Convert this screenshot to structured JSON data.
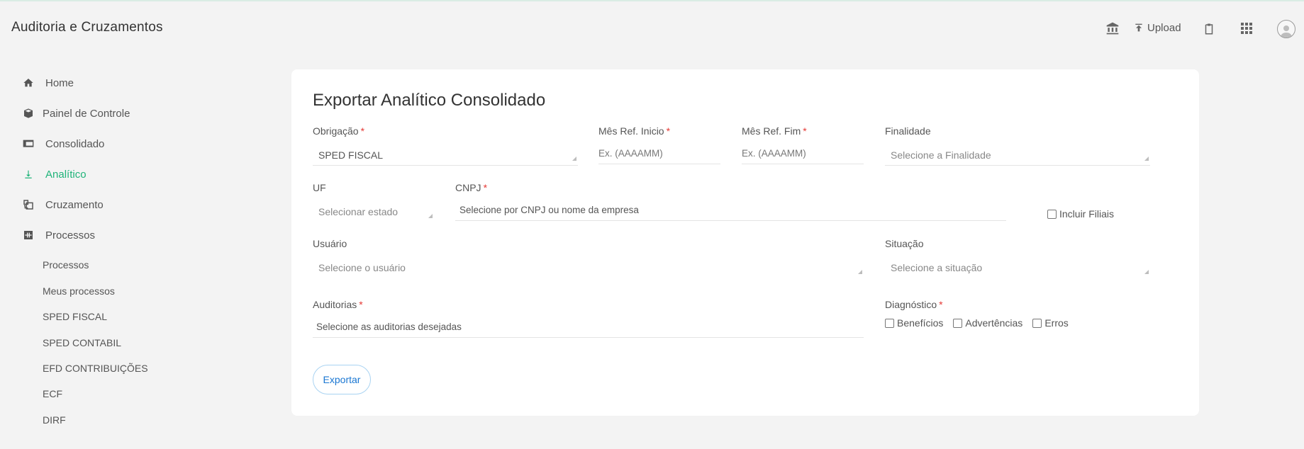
{
  "header": {
    "app_title": "Auditoria e Cruzamentos",
    "upload_label": "Upload",
    "icons": [
      "bank-icon",
      "upload-icon",
      "clipboard-icon",
      "apps-grid-icon",
      "user-avatar-icon"
    ]
  },
  "sidebar": {
    "items": [
      {
        "label": "Home",
        "icon": "home-icon"
      },
      {
        "label": "Painel de Controle",
        "icon": "box-icon"
      },
      {
        "label": "Consolidado",
        "icon": "monitor-icon"
      },
      {
        "label": "Analítico",
        "icon": "download-icon",
        "active": true
      },
      {
        "label": "Cruzamento",
        "icon": "grid-cross-icon"
      },
      {
        "label": "Processos",
        "icon": "process-icon"
      }
    ],
    "subitems": [
      "Processos",
      "Meus processos",
      "SPED FISCAL",
      "SPED CONTABIL",
      "EFD CONTRIBUIÇÕES",
      "ECF",
      "DIRF"
    ]
  },
  "form": {
    "title": "Exportar Analítico Consolidado",
    "obrigacao": {
      "label": "Obrigação",
      "required": "*",
      "value": "SPED FISCAL"
    },
    "mes_inicio": {
      "label": "Mês Ref. Inicio",
      "required": "*",
      "placeholder": "Ex. (AAAAMM)"
    },
    "mes_fim": {
      "label": "Mês Ref. Fim",
      "required": "*",
      "placeholder": "Ex. (AAAAMM)"
    },
    "finalidade": {
      "label": "Finalidade",
      "placeholder": "Selecione a Finalidade"
    },
    "uf": {
      "label": "UF",
      "placeholder": "Selecionar estado"
    },
    "cnpj": {
      "label": "CNPJ",
      "required": "*",
      "placeholder": "Selecione por CNPJ ou nome da empresa"
    },
    "incluir_filiais": {
      "label": "Incluir Filiais",
      "checked": false
    },
    "usuario": {
      "label": "Usuário",
      "placeholder": "Selecione o usuário"
    },
    "situacao": {
      "label": "Situação",
      "placeholder": "Selecione a situação"
    },
    "auditorias": {
      "label": "Auditorias",
      "required": "*",
      "placeholder": "Selecione as auditorias desejadas"
    },
    "diagnostico": {
      "label": "Diagnóstico",
      "required": "*",
      "options": [
        {
          "label": "Benefícios",
          "checked": false
        },
        {
          "label": "Advertências",
          "checked": false
        },
        {
          "label": "Erros",
          "checked": false
        }
      ]
    },
    "export_button": "Exportar"
  },
  "colors": {
    "accent": "#20b47a",
    "required": "#e53935",
    "button_text": "#1976d2",
    "button_border": "#a9d3f2",
    "background": "#f3f3f3"
  }
}
